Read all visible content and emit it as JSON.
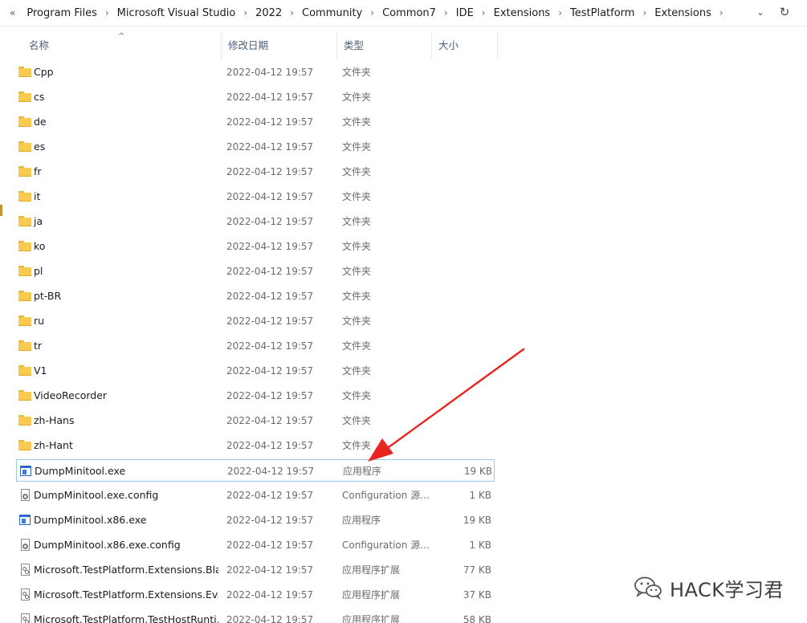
{
  "address_bar": {
    "prefix": "«",
    "crumbs": [
      "Program Files",
      "Microsoft Visual Studio",
      "2022",
      "Community",
      "Common7",
      "IDE",
      "Extensions",
      "TestPlatform",
      "Extensions"
    ],
    "separator": "›",
    "dropdown_icon": "chevron-down-icon",
    "refresh_icon": "refresh-icon"
  },
  "columns": {
    "name": "名称",
    "date": "修改日期",
    "type": "类型",
    "size": "大小",
    "sort_indicator": "^"
  },
  "files": [
    {
      "name": "Cpp",
      "date": "2022-04-12 19:57",
      "type": "文件夹",
      "size": "",
      "icon": "folder-icon"
    },
    {
      "name": "cs",
      "date": "2022-04-12 19:57",
      "type": "文件夹",
      "size": "",
      "icon": "folder-icon"
    },
    {
      "name": "de",
      "date": "2022-04-12 19:57",
      "type": "文件夹",
      "size": "",
      "icon": "folder-icon"
    },
    {
      "name": "es",
      "date": "2022-04-12 19:57",
      "type": "文件夹",
      "size": "",
      "icon": "folder-icon"
    },
    {
      "name": "fr",
      "date": "2022-04-12 19:57",
      "type": "文件夹",
      "size": "",
      "icon": "folder-icon"
    },
    {
      "name": "it",
      "date": "2022-04-12 19:57",
      "type": "文件夹",
      "size": "",
      "icon": "folder-icon"
    },
    {
      "name": "ja",
      "date": "2022-04-12 19:57",
      "type": "文件夹",
      "size": "",
      "icon": "folder-icon"
    },
    {
      "name": "ko",
      "date": "2022-04-12 19:57",
      "type": "文件夹",
      "size": "",
      "icon": "folder-icon"
    },
    {
      "name": "pl",
      "date": "2022-04-12 19:57",
      "type": "文件夹",
      "size": "",
      "icon": "folder-icon"
    },
    {
      "name": "pt-BR",
      "date": "2022-04-12 19:57",
      "type": "文件夹",
      "size": "",
      "icon": "folder-icon"
    },
    {
      "name": "ru",
      "date": "2022-04-12 19:57",
      "type": "文件夹",
      "size": "",
      "icon": "folder-icon"
    },
    {
      "name": "tr",
      "date": "2022-04-12 19:57",
      "type": "文件夹",
      "size": "",
      "icon": "folder-icon"
    },
    {
      "name": "V1",
      "date": "2022-04-12 19:57",
      "type": "文件夹",
      "size": "",
      "icon": "folder-icon"
    },
    {
      "name": "VideoRecorder",
      "date": "2022-04-12 19:57",
      "type": "文件夹",
      "size": "",
      "icon": "folder-icon"
    },
    {
      "name": "zh-Hans",
      "date": "2022-04-12 19:57",
      "type": "文件夹",
      "size": "",
      "icon": "folder-icon"
    },
    {
      "name": "zh-Hant",
      "date": "2022-04-12 19:57",
      "type": "文件夹",
      "size": "",
      "icon": "folder-icon"
    },
    {
      "name": "DumpMinitool.exe",
      "date": "2022-04-12 19:57",
      "type": "应用程序",
      "size": "19 KB",
      "icon": "exe-icon",
      "selected": true
    },
    {
      "name": "DumpMinitool.exe.config",
      "date": "2022-04-12 19:57",
      "type": "Configuration 源...",
      "size": "1 KB",
      "icon": "config-file-icon"
    },
    {
      "name": "DumpMinitool.x86.exe",
      "date": "2022-04-12 19:57",
      "type": "应用程序",
      "size": "19 KB",
      "icon": "exe-icon"
    },
    {
      "name": "DumpMinitool.x86.exe.config",
      "date": "2022-04-12 19:57",
      "type": "Configuration 源...",
      "size": "1 KB",
      "icon": "config-file-icon"
    },
    {
      "name": "Microsoft.TestPlatform.Extensions.Bla...",
      "date": "2022-04-12 19:57",
      "type": "应用程序扩展",
      "size": "77 KB",
      "icon": "dll-icon"
    },
    {
      "name": "Microsoft.TestPlatform.Extensions.Ev...",
      "date": "2022-04-12 19:57",
      "type": "应用程序扩展",
      "size": "37 KB",
      "icon": "dll-icon"
    },
    {
      "name": "Microsoft.TestPlatform.TestHostRunti...",
      "date": "2022-04-12 19:57",
      "type": "应用程序扩展",
      "size": "58 KB",
      "icon": "dll-icon"
    }
  ],
  "annotation": {
    "color": "#e8261f",
    "icon": "red-arrow-annotation"
  },
  "watermark": {
    "text": "HACK学习君",
    "icon": "wechat-logo-icon"
  },
  "colors": {
    "selection_border": "#99c9ef",
    "folder": "#f8ca4f",
    "header_text": "#4c607a"
  }
}
